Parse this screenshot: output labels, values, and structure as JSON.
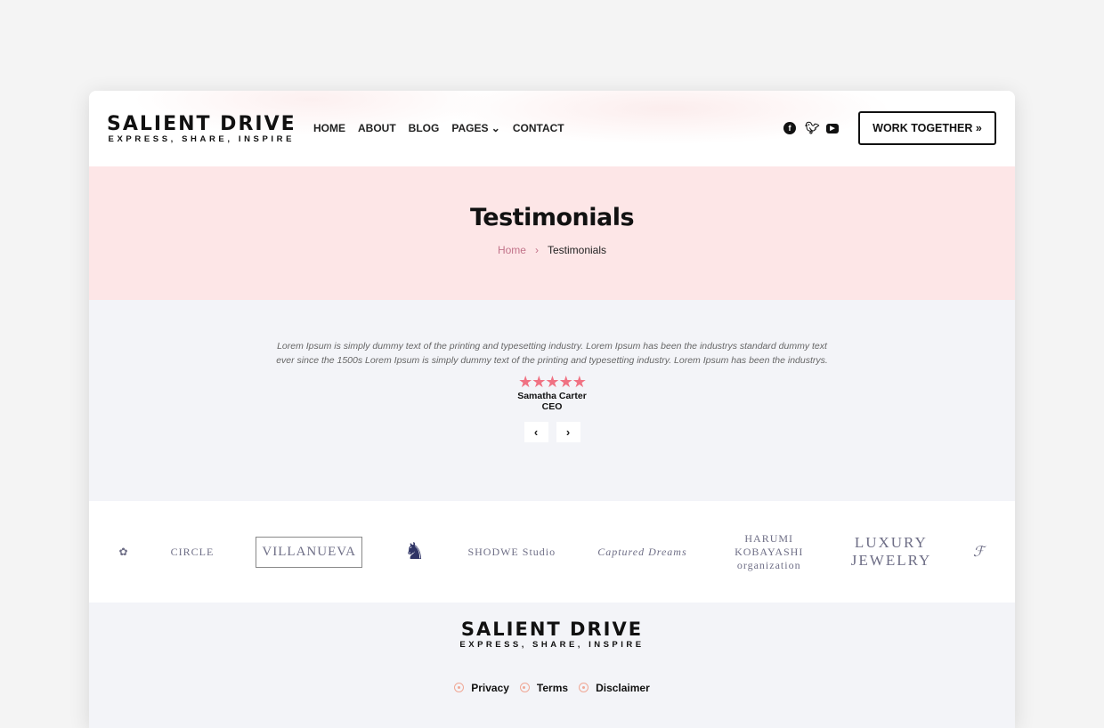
{
  "header": {
    "brand": "SALIENT DRIVE",
    "tagline": "EXPRESS, SHARE, INSPIRE",
    "nav": [
      "HOME",
      "ABOUT",
      "BLOG",
      "PAGES ⌄",
      "CONTACT"
    ],
    "social": [
      "facebook-icon",
      "twitter-icon",
      "youtube-icon"
    ],
    "cta": "WORK TOGETHER »"
  },
  "hero": {
    "title": "Testimonials",
    "breadcrumb": {
      "home": "Home",
      "sep": "›",
      "current": "Testimonials"
    }
  },
  "testimonial": {
    "quote": "Lorem Ipsum is simply dummy text of the printing and typesetting industry. Lorem Ipsum has been the industrys standard dummy text ever since the 1500s Lorem Ipsum is simply dummy text of the printing and typesetting industry. Lorem Ipsum has been the industrys.",
    "rating": 5,
    "stars": "★★★★★",
    "name": "Samatha Carter",
    "role": "CEO",
    "prev": "‹",
    "next": "›"
  },
  "logos": [
    "CIRCLE",
    "VILLANUEVA",
    "SHODWE Studio",
    "Captured Dreams",
    "HARUMI KOBAYASHI organization",
    "LUXURY JEWELRY"
  ],
  "footer": {
    "brand": "SALIENT DRIVE",
    "tagline": "EXPRESS, SHARE, INSPIRE",
    "links": [
      "Privacy",
      "Terms",
      "Disclaimer"
    ]
  },
  "colors": {
    "hero_bg": "#fde6e7",
    "accent_star": "#f07283",
    "section_bg": "#f3f4f8"
  }
}
